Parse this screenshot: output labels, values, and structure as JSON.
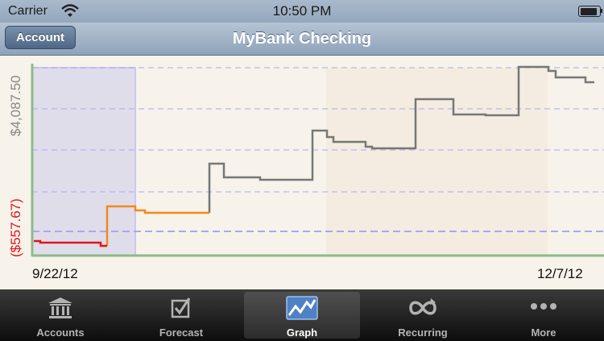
{
  "status_bar": {
    "carrier": "Carrier",
    "time": "10:50 PM",
    "battery_level": 0.9
  },
  "nav_bar": {
    "back_label": "Account",
    "title": "MyBank Checking"
  },
  "graph": {
    "x_start_label": "9/22/12",
    "x_end_label": "12/7/12",
    "y_high_label": "$4,087.50",
    "y_low_label": "($557.67)",
    "colors": {
      "negative": "#e0141b",
      "forecast": "#f08a1c",
      "balance": "#777777",
      "axis": "#8cbb8c",
      "grid": "#a9a9ee",
      "selection": "#c9c9f2"
    }
  },
  "tab_bar": {
    "items": [
      {
        "label": "Accounts",
        "icon": "bank-icon"
      },
      {
        "label": "Forecast",
        "icon": "checkbox-icon"
      },
      {
        "label": "Graph",
        "icon": "graph-icon",
        "selected": true
      },
      {
        "label": "Recurring",
        "icon": "recurring-icon"
      },
      {
        "label": "More",
        "icon": "more-icon"
      }
    ]
  }
}
